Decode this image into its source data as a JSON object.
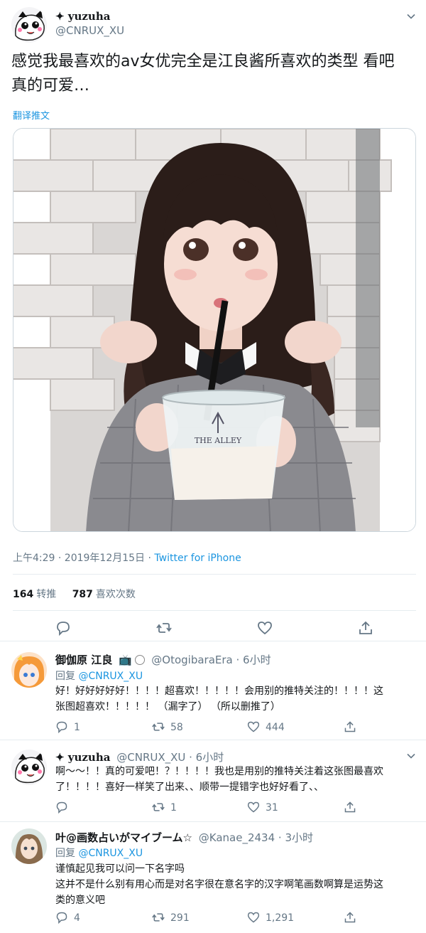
{
  "main_tweet": {
    "display_name": "✦ yuzuha",
    "handle": "@CNRUX_XU",
    "text_line1": "感觉我最喜欢的av女优完全是江良酱所喜欢的类型 看吧",
    "text_line2": "真的可爱…",
    "translate_label": "翻译推文",
    "time": "上午4:29 · 2019年12月15日 · ",
    "source": "Twitter for iPhone",
    "retweets": "164",
    "retweets_label": "转推",
    "likes": "787",
    "likes_label": "喜欢次数"
  },
  "replies": [
    {
      "display_name": "御伽原 江良",
      "handle_time": "@OtogibaraEra · 6小时",
      "reply_prefix": "回复 ",
      "reply_target": "@CNRUX_XU",
      "line1": "好！好好好好好！！！！超喜欢！！！！！会用别的推特关注的！！！！这",
      "line2": "张图超喜欢！！！！！ （漏字了） （所以删推了）",
      "replies": "1",
      "retweets": "58",
      "likes": "444"
    },
    {
      "display_name": "✦ yuzuha",
      "handle_time": "@CNRUX_XU · 6小时",
      "line1": "啊〜〜！！真的可爱吧！？！！！！我也是用别的推特关注着这张图最喜欢",
      "line2": "了！！！！喜好一样笑了出来、、顺带一提错字也好好看了、、",
      "replies": "",
      "retweets": "1",
      "likes": "31"
    },
    {
      "display_name": "叶@画数占いがマイブーム☆",
      "handle_time": "@Kanae_2434 · 3小时",
      "reply_prefix": "回复 ",
      "reply_target": "@CNRUX_XU",
      "line1": "谨慎起见我可以问一下名字吗",
      "line2": "这并不是什么别有用心而是对名字很在意名字的汉字啊笔画数啊算是运势这",
      "line3": "类的意义吧",
      "replies": "4",
      "retweets": "291",
      "likes": "1,291"
    }
  ]
}
